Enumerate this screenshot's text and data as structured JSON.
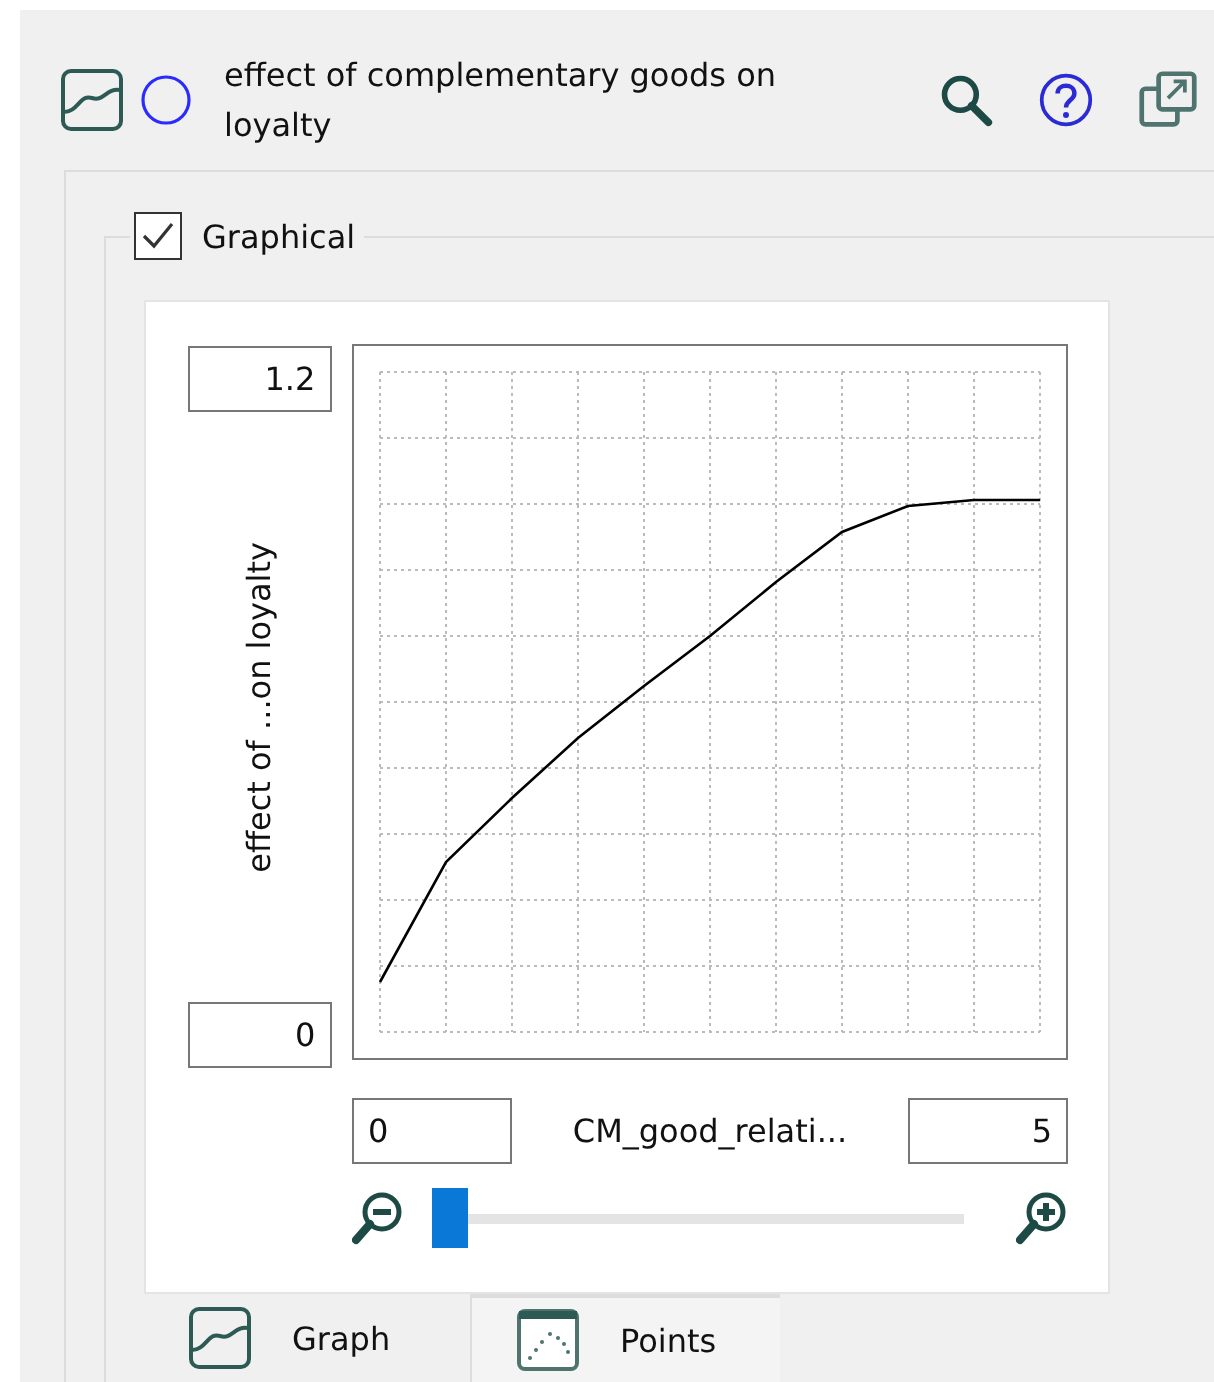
{
  "header": {
    "title": "effect of complementary goods on loyalty"
  },
  "group": {
    "label": "Graphical",
    "checked": true
  },
  "graph": {
    "y_max": "1.2",
    "y_min": "0",
    "y_label": "effect of ...on loyalty",
    "x_min": "0",
    "x_label": "CM_good_relati...",
    "x_max": "5",
    "zoom": {
      "level": 0.0
    }
  },
  "tabs": [
    {
      "label": "Graph",
      "kind": "graph",
      "selected": true
    },
    {
      "label": "Points",
      "kind": "points",
      "selected": false
    }
  ]
}
